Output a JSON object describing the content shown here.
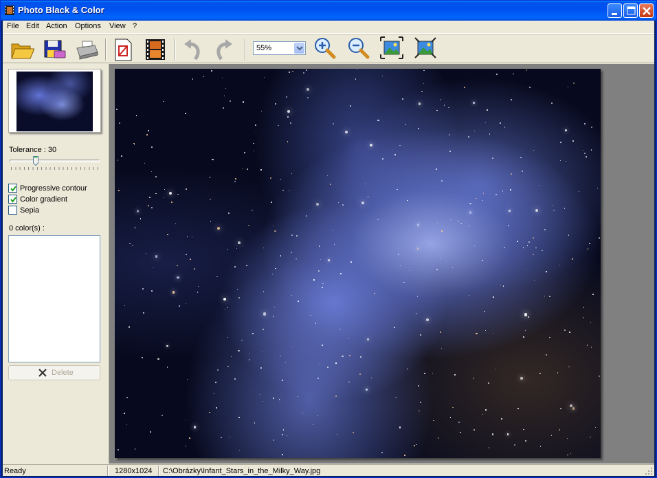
{
  "window": {
    "title": "Photo Black & Color",
    "title_bar_color": "#0054e3"
  },
  "menu": {
    "items": [
      "File",
      "Edit",
      "Action",
      "Options",
      "View",
      "?"
    ]
  },
  "toolbar": {
    "buttons": [
      {
        "name": "open-icon"
      },
      {
        "name": "save-icon"
      },
      {
        "name": "print-icon"
      },
      {
        "name": "page-setup-icon"
      },
      {
        "name": "filmstrip-icon"
      },
      {
        "name": "undo-icon"
      },
      {
        "name": "redo-icon"
      },
      {
        "name": "zoom-in-icon"
      },
      {
        "name": "zoom-out-icon"
      },
      {
        "name": "fit-window-icon"
      },
      {
        "name": "actual-size-icon"
      }
    ],
    "zoom_value": "55%"
  },
  "panel": {
    "tolerance_label": "Tolerance : 30",
    "tolerance_value": 30,
    "tolerance_fraction": 0.3,
    "checkboxes": [
      {
        "label": "Progressive contour",
        "checked": true
      },
      {
        "label": "Color gradient",
        "checked": true
      },
      {
        "label": "Sepia",
        "checked": false
      }
    ],
    "colors_label": "0 color(s) :",
    "delete_label": "Delete"
  },
  "status": {
    "state": "Ready",
    "dimensions": "1280x1024",
    "path": "C:\\Obrázky\\Infant_Stars_in_the_Milky_Way.jpg"
  }
}
